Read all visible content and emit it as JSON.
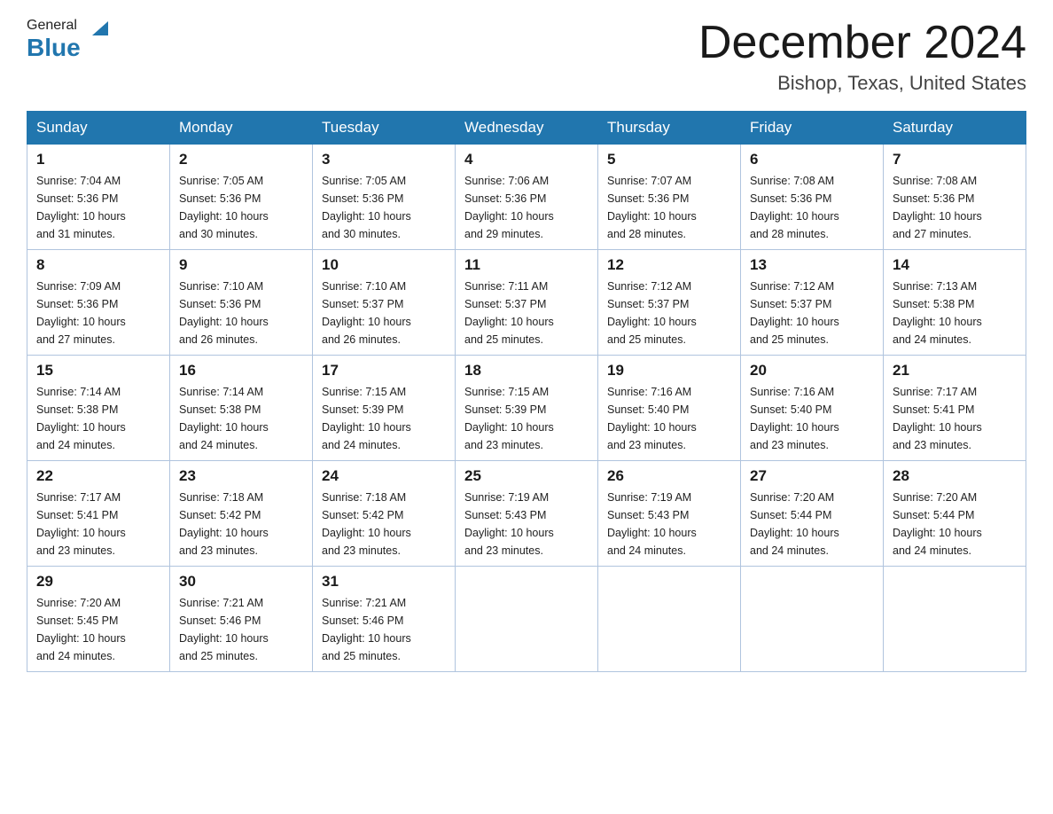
{
  "logo": {
    "general": "General",
    "triangle": "▲",
    "blue": "Blue"
  },
  "header": {
    "month": "December 2024",
    "location": "Bishop, Texas, United States"
  },
  "weekdays": [
    "Sunday",
    "Monday",
    "Tuesday",
    "Wednesday",
    "Thursday",
    "Friday",
    "Saturday"
  ],
  "weeks": [
    [
      {
        "day": "1",
        "sunrise": "7:04 AM",
        "sunset": "5:36 PM",
        "daylight": "10 hours and 31 minutes."
      },
      {
        "day": "2",
        "sunrise": "7:05 AM",
        "sunset": "5:36 PM",
        "daylight": "10 hours and 30 minutes."
      },
      {
        "day": "3",
        "sunrise": "7:05 AM",
        "sunset": "5:36 PM",
        "daylight": "10 hours and 30 minutes."
      },
      {
        "day": "4",
        "sunrise": "7:06 AM",
        "sunset": "5:36 PM",
        "daylight": "10 hours and 29 minutes."
      },
      {
        "day": "5",
        "sunrise": "7:07 AM",
        "sunset": "5:36 PM",
        "daylight": "10 hours and 28 minutes."
      },
      {
        "day": "6",
        "sunrise": "7:08 AM",
        "sunset": "5:36 PM",
        "daylight": "10 hours and 28 minutes."
      },
      {
        "day": "7",
        "sunrise": "7:08 AM",
        "sunset": "5:36 PM",
        "daylight": "10 hours and 27 minutes."
      }
    ],
    [
      {
        "day": "8",
        "sunrise": "7:09 AM",
        "sunset": "5:36 PM",
        "daylight": "10 hours and 27 minutes."
      },
      {
        "day": "9",
        "sunrise": "7:10 AM",
        "sunset": "5:36 PM",
        "daylight": "10 hours and 26 minutes."
      },
      {
        "day": "10",
        "sunrise": "7:10 AM",
        "sunset": "5:37 PM",
        "daylight": "10 hours and 26 minutes."
      },
      {
        "day": "11",
        "sunrise": "7:11 AM",
        "sunset": "5:37 PM",
        "daylight": "10 hours and 25 minutes."
      },
      {
        "day": "12",
        "sunrise": "7:12 AM",
        "sunset": "5:37 PM",
        "daylight": "10 hours and 25 minutes."
      },
      {
        "day": "13",
        "sunrise": "7:12 AM",
        "sunset": "5:37 PM",
        "daylight": "10 hours and 25 minutes."
      },
      {
        "day": "14",
        "sunrise": "7:13 AM",
        "sunset": "5:38 PM",
        "daylight": "10 hours and 24 minutes."
      }
    ],
    [
      {
        "day": "15",
        "sunrise": "7:14 AM",
        "sunset": "5:38 PM",
        "daylight": "10 hours and 24 minutes."
      },
      {
        "day": "16",
        "sunrise": "7:14 AM",
        "sunset": "5:38 PM",
        "daylight": "10 hours and 24 minutes."
      },
      {
        "day": "17",
        "sunrise": "7:15 AM",
        "sunset": "5:39 PM",
        "daylight": "10 hours and 24 minutes."
      },
      {
        "day": "18",
        "sunrise": "7:15 AM",
        "sunset": "5:39 PM",
        "daylight": "10 hours and 23 minutes."
      },
      {
        "day": "19",
        "sunrise": "7:16 AM",
        "sunset": "5:40 PM",
        "daylight": "10 hours and 23 minutes."
      },
      {
        "day": "20",
        "sunrise": "7:16 AM",
        "sunset": "5:40 PM",
        "daylight": "10 hours and 23 minutes."
      },
      {
        "day": "21",
        "sunrise": "7:17 AM",
        "sunset": "5:41 PM",
        "daylight": "10 hours and 23 minutes."
      }
    ],
    [
      {
        "day": "22",
        "sunrise": "7:17 AM",
        "sunset": "5:41 PM",
        "daylight": "10 hours and 23 minutes."
      },
      {
        "day": "23",
        "sunrise": "7:18 AM",
        "sunset": "5:42 PM",
        "daylight": "10 hours and 23 minutes."
      },
      {
        "day": "24",
        "sunrise": "7:18 AM",
        "sunset": "5:42 PM",
        "daylight": "10 hours and 23 minutes."
      },
      {
        "day": "25",
        "sunrise": "7:19 AM",
        "sunset": "5:43 PM",
        "daylight": "10 hours and 23 minutes."
      },
      {
        "day": "26",
        "sunrise": "7:19 AM",
        "sunset": "5:43 PM",
        "daylight": "10 hours and 24 minutes."
      },
      {
        "day": "27",
        "sunrise": "7:20 AM",
        "sunset": "5:44 PM",
        "daylight": "10 hours and 24 minutes."
      },
      {
        "day": "28",
        "sunrise": "7:20 AM",
        "sunset": "5:44 PM",
        "daylight": "10 hours and 24 minutes."
      }
    ],
    [
      {
        "day": "29",
        "sunrise": "7:20 AM",
        "sunset": "5:45 PM",
        "daylight": "10 hours and 24 minutes."
      },
      {
        "day": "30",
        "sunrise": "7:21 AM",
        "sunset": "5:46 PM",
        "daylight": "10 hours and 25 minutes."
      },
      {
        "day": "31",
        "sunrise": "7:21 AM",
        "sunset": "5:46 PM",
        "daylight": "10 hours and 25 minutes."
      },
      null,
      null,
      null,
      null
    ]
  ],
  "labels": {
    "sunrise": "Sunrise:",
    "sunset": "Sunset:",
    "daylight": "Daylight:"
  }
}
